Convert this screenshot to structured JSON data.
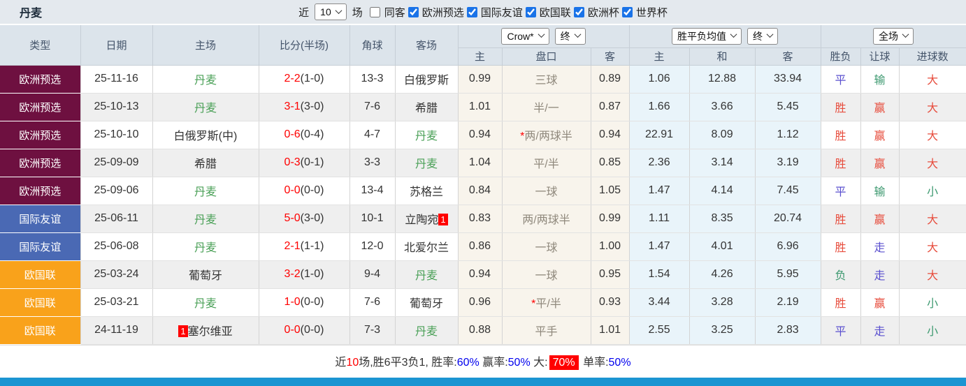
{
  "topbar": {
    "title": "丹麦",
    "recent_label": "近",
    "recent_value": "10",
    "matches_label": "场",
    "same_venue": {
      "label": "同客",
      "checked": false
    },
    "league_filters": [
      {
        "label": "欧洲预选",
        "checked": true
      },
      {
        "label": "国际友谊",
        "checked": true
      },
      {
        "label": "欧国联",
        "checked": true
      },
      {
        "label": "欧洲杯",
        "checked": true
      },
      {
        "label": "世界杯",
        "checked": true
      }
    ]
  },
  "header": {
    "columns": [
      "类型",
      "日期",
      "主场",
      "比分(半场)",
      "角球",
      "客场"
    ],
    "odds_group": {
      "company_select": "Crow*",
      "time_select": "终",
      "sub": [
        "主",
        "盘口",
        "客"
      ]
    },
    "avg_group": {
      "metric_select": "胜平负均值",
      "time_select": "终",
      "sub": [
        "主",
        "和",
        "客"
      ]
    },
    "result_group": {
      "scope_select": "全场",
      "sub": [
        "胜负",
        "让球",
        "进球数"
      ]
    }
  },
  "type_colors": {
    "欧洲预选": "#6e1040",
    "国际友谊": "#4a69b4",
    "欧国联": "#f9a21b"
  },
  "rows": [
    {
      "type": "欧洲预选",
      "date": "25-11-16",
      "home": {
        "name": "丹麦",
        "green": true
      },
      "score_ft": "2-2",
      "score_ht": "(1-0)",
      "corner": "13-3",
      "away": {
        "name": "白俄罗斯"
      },
      "odds_home": "0.99",
      "handicap": "三球",
      "handicap_star": false,
      "odds_away": "0.89",
      "avg_home": "1.06",
      "avg_draw": "12.88",
      "avg_away": "33.94",
      "res": [
        [
          "平",
          "blue"
        ],
        [
          "输",
          "green"
        ],
        [
          "大",
          "red"
        ]
      ]
    },
    {
      "type": "欧洲预选",
      "date": "25-10-13",
      "home": {
        "name": "丹麦",
        "green": true
      },
      "score_ft": "3-1",
      "score_ht": "(3-0)",
      "corner": "7-6",
      "away": {
        "name": "希腊"
      },
      "odds_home": "1.01",
      "handicap": "半/一",
      "handicap_star": false,
      "odds_away": "0.87",
      "avg_home": "1.66",
      "avg_draw": "3.66",
      "avg_away": "5.45",
      "res": [
        [
          "胜",
          "red"
        ],
        [
          "赢",
          "red"
        ],
        [
          "大",
          "red"
        ]
      ]
    },
    {
      "type": "欧洲预选",
      "date": "25-10-10",
      "home": {
        "name": "白俄罗斯(中)"
      },
      "score_ft": "0-6",
      "score_ht": "(0-4)",
      "corner": "4-7",
      "away": {
        "name": "丹麦",
        "green": true
      },
      "odds_home": "0.94",
      "handicap": "两/两球半",
      "handicap_star": true,
      "odds_away": "0.94",
      "avg_home": "22.91",
      "avg_draw": "8.09",
      "avg_away": "1.12",
      "res": [
        [
          "胜",
          "red"
        ],
        [
          "赢",
          "red"
        ],
        [
          "大",
          "red"
        ]
      ]
    },
    {
      "type": "欧洲预选",
      "date": "25-09-09",
      "home": {
        "name": "希腊"
      },
      "score_ft": "0-3",
      "score_ht": "(0-1)",
      "corner": "3-3",
      "away": {
        "name": "丹麦",
        "green": true
      },
      "odds_home": "1.04",
      "handicap": "平/半",
      "handicap_star": false,
      "odds_away": "0.85",
      "avg_home": "2.36",
      "avg_draw": "3.14",
      "avg_away": "3.19",
      "res": [
        [
          "胜",
          "red"
        ],
        [
          "赢",
          "red"
        ],
        [
          "大",
          "red"
        ]
      ]
    },
    {
      "type": "欧洲预选",
      "date": "25-09-06",
      "home": {
        "name": "丹麦",
        "green": true
      },
      "score_ft": "0-0",
      "score_ht": "(0-0)",
      "corner": "13-4",
      "away": {
        "name": "苏格兰"
      },
      "odds_home": "0.84",
      "handicap": "一球",
      "handicap_star": false,
      "odds_away": "1.05",
      "avg_home": "1.47",
      "avg_draw": "4.14",
      "avg_away": "7.45",
      "res": [
        [
          "平",
          "blue"
        ],
        [
          "输",
          "green"
        ],
        [
          "小",
          "green"
        ]
      ]
    },
    {
      "type": "国际友谊",
      "date": "25-06-11",
      "home": {
        "name": "丹麦",
        "green": true
      },
      "score_ft": "5-0",
      "score_ht": "(3-0)",
      "corner": "10-1",
      "away": {
        "name": "立陶宛",
        "badge": "1",
        "badge_pos": "after"
      },
      "odds_home": "0.83",
      "handicap": "两/两球半",
      "handicap_star": false,
      "odds_away": "0.99",
      "avg_home": "1.11",
      "avg_draw": "8.35",
      "avg_away": "20.74",
      "res": [
        [
          "胜",
          "red"
        ],
        [
          "赢",
          "red"
        ],
        [
          "大",
          "red"
        ]
      ]
    },
    {
      "type": "国际友谊",
      "date": "25-06-08",
      "home": {
        "name": "丹麦",
        "green": true
      },
      "score_ft": "2-1",
      "score_ht": "(1-1)",
      "corner": "12-0",
      "away": {
        "name": "北爱尔兰"
      },
      "odds_home": "0.86",
      "handicap": "一球",
      "handicap_star": false,
      "odds_away": "1.00",
      "avg_home": "1.47",
      "avg_draw": "4.01",
      "avg_away": "6.96",
      "res": [
        [
          "胜",
          "red"
        ],
        [
          "走",
          "blue"
        ],
        [
          "大",
          "red"
        ]
      ]
    },
    {
      "type": "欧国联",
      "date": "25-03-24",
      "home": {
        "name": "葡萄牙"
      },
      "score_ft": "3-2",
      "score_ht": "(1-0)",
      "corner": "9-4",
      "away": {
        "name": "丹麦",
        "green": true
      },
      "odds_home": "0.94",
      "handicap": "一球",
      "handicap_star": false,
      "odds_away": "0.95",
      "avg_home": "1.54",
      "avg_draw": "4.26",
      "avg_away": "5.95",
      "res": [
        [
          "负",
          "green"
        ],
        [
          "走",
          "blue"
        ],
        [
          "大",
          "red"
        ]
      ]
    },
    {
      "type": "欧国联",
      "date": "25-03-21",
      "home": {
        "name": "丹麦",
        "green": true
      },
      "score_ft": "1-0",
      "score_ht": "(0-0)",
      "corner": "7-6",
      "away": {
        "name": "葡萄牙"
      },
      "odds_home": "0.96",
      "handicap": "平/半",
      "handicap_star": true,
      "odds_away": "0.93",
      "avg_home": "3.44",
      "avg_draw": "3.28",
      "avg_away": "2.19",
      "res": [
        [
          "胜",
          "red"
        ],
        [
          "赢",
          "red"
        ],
        [
          "小",
          "green"
        ]
      ]
    },
    {
      "type": "欧国联",
      "date": "24-11-19",
      "home": {
        "name": "塞尔维亚",
        "badge": "1",
        "badge_pos": "before"
      },
      "score_ft": "0-0",
      "score_ht": "(0-0)",
      "corner": "7-3",
      "away": {
        "name": "丹麦",
        "green": true
      },
      "odds_home": "0.88",
      "handicap": "平手",
      "handicap_star": false,
      "odds_away": "1.01",
      "avg_home": "2.55",
      "avg_draw": "3.25",
      "avg_away": "2.83",
      "res": [
        [
          "平",
          "blue"
        ],
        [
          "走",
          "blue"
        ],
        [
          "小",
          "green"
        ]
      ]
    }
  ],
  "footer": {
    "segments": [
      {
        "t": "近",
        "c": "dark"
      },
      {
        "t": "10",
        "c": "red"
      },
      {
        "t": "场,胜6平3负1, 胜率:",
        "c": "dark"
      },
      {
        "t": "60%",
        "c": "blue"
      },
      {
        "t": " 赢率:",
        "c": "dark"
      },
      {
        "t": "50%",
        "c": "blue"
      },
      {
        "t": " 大:",
        "c": "dark"
      },
      {
        "t": "70%",
        "c": "redbg"
      },
      {
        "t": " 单率:",
        "c": "dark"
      },
      {
        "t": "50%",
        "c": "blue"
      }
    ]
  },
  "accent": {
    "bottom_bar": "#1b95d2"
  }
}
